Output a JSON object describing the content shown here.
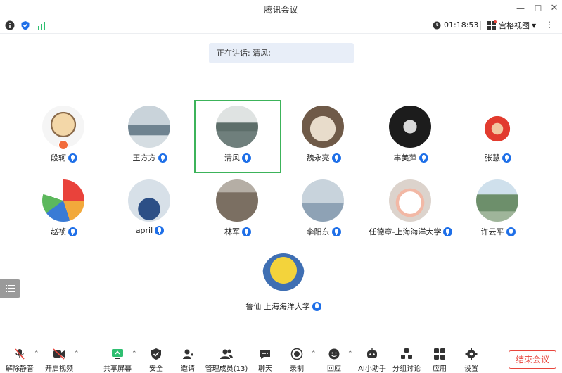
{
  "window": {
    "title": "腾讯会议"
  },
  "infobar": {
    "timer": "01:18:53",
    "view_label": "宫格视图"
  },
  "speaking_banner": "正在讲话: 清风;",
  "participants": [
    {
      "name": "段轲",
      "avatar_color": "#d9b07a",
      "host": true
    },
    {
      "name": "王方方",
      "avatar_color": "#8fa3b3"
    },
    {
      "name": "清风",
      "avatar_color": "#7d8d86",
      "active": true
    },
    {
      "name": "魏永亮",
      "avatar_color": "#b7a48f"
    },
    {
      "name": "丰美萍",
      "avatar_color": "#2b2b2b"
    },
    {
      "name": "张慧",
      "avatar_color": "#f4f4f4"
    },
    {
      "name": "赵祯",
      "avatar_color": "#ffffff"
    },
    {
      "name": "april",
      "avatar_color": "#6a8fb0"
    },
    {
      "name": "林军",
      "avatar_color": "#7b6f62"
    },
    {
      "name": "李阳东",
      "avatar_color": "#9fb3c6"
    },
    {
      "name": "任德章-上海海洋大学",
      "avatar_color": "#e7e1dc"
    },
    {
      "name": "许云平",
      "avatar_color": "#7f9d7b"
    },
    {
      "name": "鲁仙  上海海洋大学",
      "avatar_color": "#f3d33b"
    }
  ],
  "toolbar": {
    "unmute": "解除静音",
    "video": "开启视频",
    "share": "共享屏幕",
    "security": "安全",
    "invite": "邀请",
    "members": "管理成员(13)",
    "chat": "聊天",
    "record": "录制",
    "reply": "回应",
    "ai": "AI小助手",
    "breakout": "分组讨论",
    "apps": "应用",
    "settings": "设置",
    "end": "结束会议"
  },
  "colors": {
    "mic_blue": "#1e6fe8",
    "active_border": "#3cb35a",
    "end_red": "#e8453c",
    "banner_bg": "#e8eef8"
  }
}
